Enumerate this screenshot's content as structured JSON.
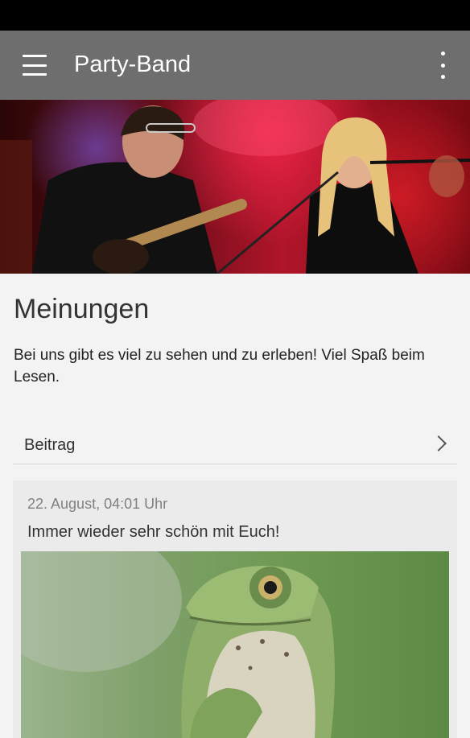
{
  "app": {
    "title": "Party-Band",
    "menu_icon": "hamburger-menu-icon",
    "more_icon": "more-vert-icon"
  },
  "hero": {
    "description_icon": "band-photo"
  },
  "section": {
    "title": "Meinungen",
    "description": "Bei uns gibt es viel zu sehen und zu erleben! Viel Spaß beim Lesen."
  },
  "beitrag": {
    "label": "Beitrag",
    "icon": "chevron-right-icon"
  },
  "post": {
    "date": "22. August, 04:01 Uhr",
    "text": "Immer wieder sehr schön mit Euch!",
    "image": "frog-photo"
  },
  "colors": {
    "appbar": "#6e6e6e",
    "statusbar": "#000000",
    "background": "#f3f3f3",
    "card": "#ebebeb"
  }
}
